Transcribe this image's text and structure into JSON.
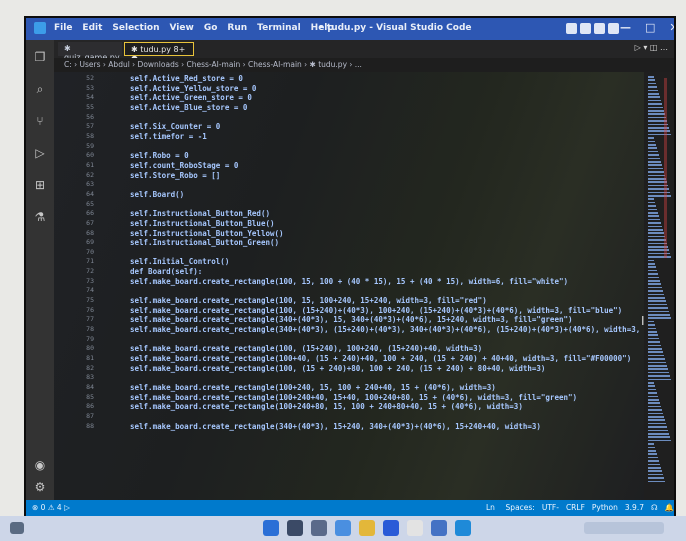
{
  "titlebar": {
    "menu": [
      "File",
      "Edit",
      "Selection",
      "View",
      "Go",
      "Run",
      "Terminal",
      "Help"
    ],
    "title": "• tudu.py - Visual Studio Code",
    "controls": [
      "—",
      "□",
      "✕"
    ]
  },
  "tabs": [
    {
      "label": "✱ quiz_game.py"
    },
    {
      "label": "✱ tudu.py  8+ ●"
    }
  ],
  "tab_actions": "▷ ▾ ◫ …",
  "breadcrumb": "C: › Users › Abdul › Downloads › Chess-AI-main › Chess-AI-main › ✱ tudu.py › ...",
  "line_numbers": [
    "52",
    "53",
    "54",
    "55",
    "56",
    "57",
    "58",
    "59",
    "60",
    "61",
    "62",
    "63",
    "64",
    "65",
    "66",
    "67",
    "68",
    "69",
    "70",
    "71",
    "72",
    "73",
    "74",
    "75",
    "76",
    "77",
    "78",
    "79",
    "80",
    "81",
    "82",
    "83",
    "84",
    "85",
    "86",
    "87",
    "88",
    "89",
    "90",
    "91",
    "92",
    "93",
    "94",
    "95",
    "96",
    "97",
    "98",
    "99",
    "100",
    "101",
    "102",
    "103",
    "104",
    "105"
  ],
  "code_lines": [
    "self.Active_Red_store = 0",
    "self.Active_Yellow_store = 0",
    "self.Active_Green_store = 0",
    "self.Active_Blue_store = 0",
    "",
    "self.Six_Counter = 0",
    "self.timefor = -1",
    "",
    "self.Robo = 0",
    "self.count_RoboStage = 0",
    "self.Store_Robo = []",
    "",
    "self.Board()",
    "",
    "self.Instructional_Button_Red()",
    "self.Instructional_Button_Blue()",
    "self.Instructional_Button_Yellow()",
    "self.Instructional_Button_Green()",
    "",
    "self.Initial_Control()",
    "def Board(self):",
    "self.make_board.create_rectangle(100, 15, 100 + (40 * 15), 15 + (40 * 15), width=6, fill=\"white\")",
    "",
    "self.make_board.create_rectangle(100, 15, 100+240, 15+240, width=3, fill=\"red\")",
    "self.make_board.create_rectangle(100, (15+240)+(40*3), 100+240, (15+240)+(40*3)+(40*6), width=3, fill=\"blue\")",
    "self.make_board.create_rectangle(340+(40*3), 15, 340+(40*3)+(40*6), 15+240, width=3, fill=\"green\")",
    "self.make_board.create_rectangle(340+(40*3), (15+240)+(40*3), 340+(40*3)+(40*6), (15+240)+(40*3)+(40*6), width=3, fill=\"yellow\")",
    "",
    "self.make_board.create_rectangle(100, (15+240), 100+240, (15+240)+40, width=3)",
    "self.make_board.create_rectangle(100+40, (15 + 240)+40, 100 + 240, (15 + 240) + 40+40, width=3, fill=\"#F00000\")",
    "self.make_board.create_rectangle(100, (15 + 240)+80, 100 + 240, (15 + 240) + 80+40, width=3)",
    "",
    "self.make_board.create_rectangle(100+240, 15, 100 + 240+40, 15 + (40*6), width=3)",
    "self.make_board.create_rectangle(100+240+40, 15+40, 100+240+80, 15 + (40*6), width=3, fill=\"green\")",
    "self.make_board.create_rectangle(100+240+80, 15, 100 + 240+80+40, 15 + (40*6), width=3)",
    "",
    "self.make_board.create_rectangle(340+(40*3), 15+240, 340+(40*3)+(40*6), 15+240+40, width=3)"
  ],
  "statusbar": {
    "left": "⊗ 0 ⚠ 4   ▷",
    "right": [
      "Ln 1, Col 1",
      "Spaces: 4",
      "UTF-8",
      "CRLF",
      "Python",
      "3.9.7 64-bit",
      "☊",
      "🔔"
    ]
  }
}
